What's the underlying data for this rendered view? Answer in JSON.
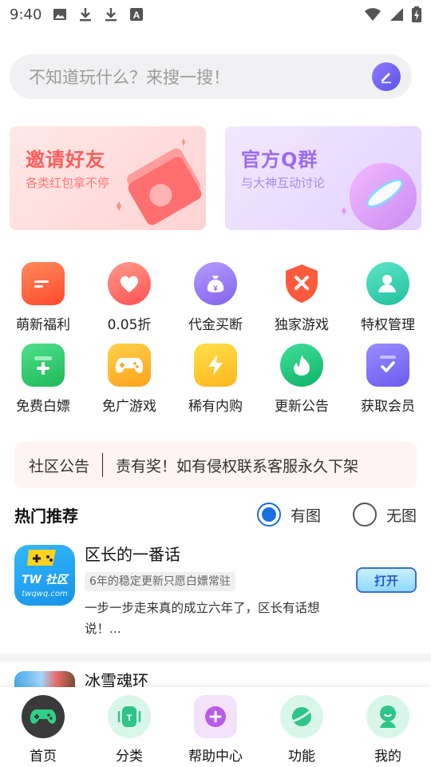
{
  "status_bar": {
    "time": "9:40",
    "left_icons": [
      "image-icon",
      "download-icon",
      "download-icon",
      "font-icon"
    ],
    "right_icons": [
      "wifi-icon",
      "signal-icon",
      "battery-charging-icon"
    ]
  },
  "search": {
    "placeholder": "不知道玩什么？来搜一搜！",
    "button_icon": "edit-pencil-icon",
    "accent": "#6a5cf0"
  },
  "banners": [
    {
      "title": "邀请好友",
      "subtitle": "各类红包拿不停",
      "color": "#ff5c5c"
    },
    {
      "title": "官方Q群",
      "subtitle": "与大神互动讨论",
      "color": "#9a6bf2"
    }
  ],
  "grid": {
    "rows": [
      [
        {
          "label": "萌新福利",
          "icon": "folder-icon",
          "color": "#ff5a3c"
        },
        {
          "label": "0.05折",
          "icon": "heart-icon",
          "color": "#ff6b6b"
        },
        {
          "label": "代金买断",
          "icon": "money-bag-icon",
          "color": "#9b7bf0"
        },
        {
          "label": "独家游戏",
          "icon": "shield-icon",
          "color": "#ff5a3c"
        },
        {
          "label": "特权管理",
          "icon": "user-icon",
          "color": "#2fd1b0"
        }
      ],
      [
        {
          "label": "免费白嫖",
          "icon": "card-plus-icon",
          "color": "#2cc66a"
        },
        {
          "label": "免广游戏",
          "icon": "gamepad-icon",
          "color": "#ffb21c"
        },
        {
          "label": "稀有内购",
          "icon": "lightning-icon",
          "color": "#ffc21c"
        },
        {
          "label": "更新公告",
          "icon": "flame-icon",
          "color": "#1cc07a"
        },
        {
          "label": "获取会员",
          "icon": "check-badge-icon",
          "color": "#7a6af0"
        }
      ]
    ]
  },
  "notice": {
    "label": "社区公告",
    "text": "责有奖！如有侵权联系客服永久下架"
  },
  "recommend": {
    "title": "热门推荐",
    "options": [
      {
        "label": "有图",
        "checked": true
      },
      {
        "label": "无图",
        "checked": false
      }
    ],
    "accent": "#1a6fe0"
  },
  "items": [
    {
      "title": "区长的一番话",
      "tag": "6年的稳定更新只愿白嫖常驻",
      "description": "一步一步走来真的成立六年了，区长有话想说！...",
      "button": "打开",
      "logo_text": "TW 社区",
      "logo_sub": "twqwq.com"
    },
    {
      "title": "冰雪魂环"
    }
  ],
  "tabbar": [
    {
      "label": "首页",
      "icon": "gamepad-icon",
      "color": "#3a3a3a"
    },
    {
      "label": "分类",
      "icon": "category-icon",
      "color": "#2fc48a"
    },
    {
      "label": "帮助中心",
      "icon": "plus-circle-icon",
      "color": "#b85ce8"
    },
    {
      "label": "功能",
      "icon": "planet-icon",
      "color": "#2fc48a"
    },
    {
      "label": "我的",
      "icon": "avatar-icon",
      "color": "#2fc48a"
    }
  ]
}
